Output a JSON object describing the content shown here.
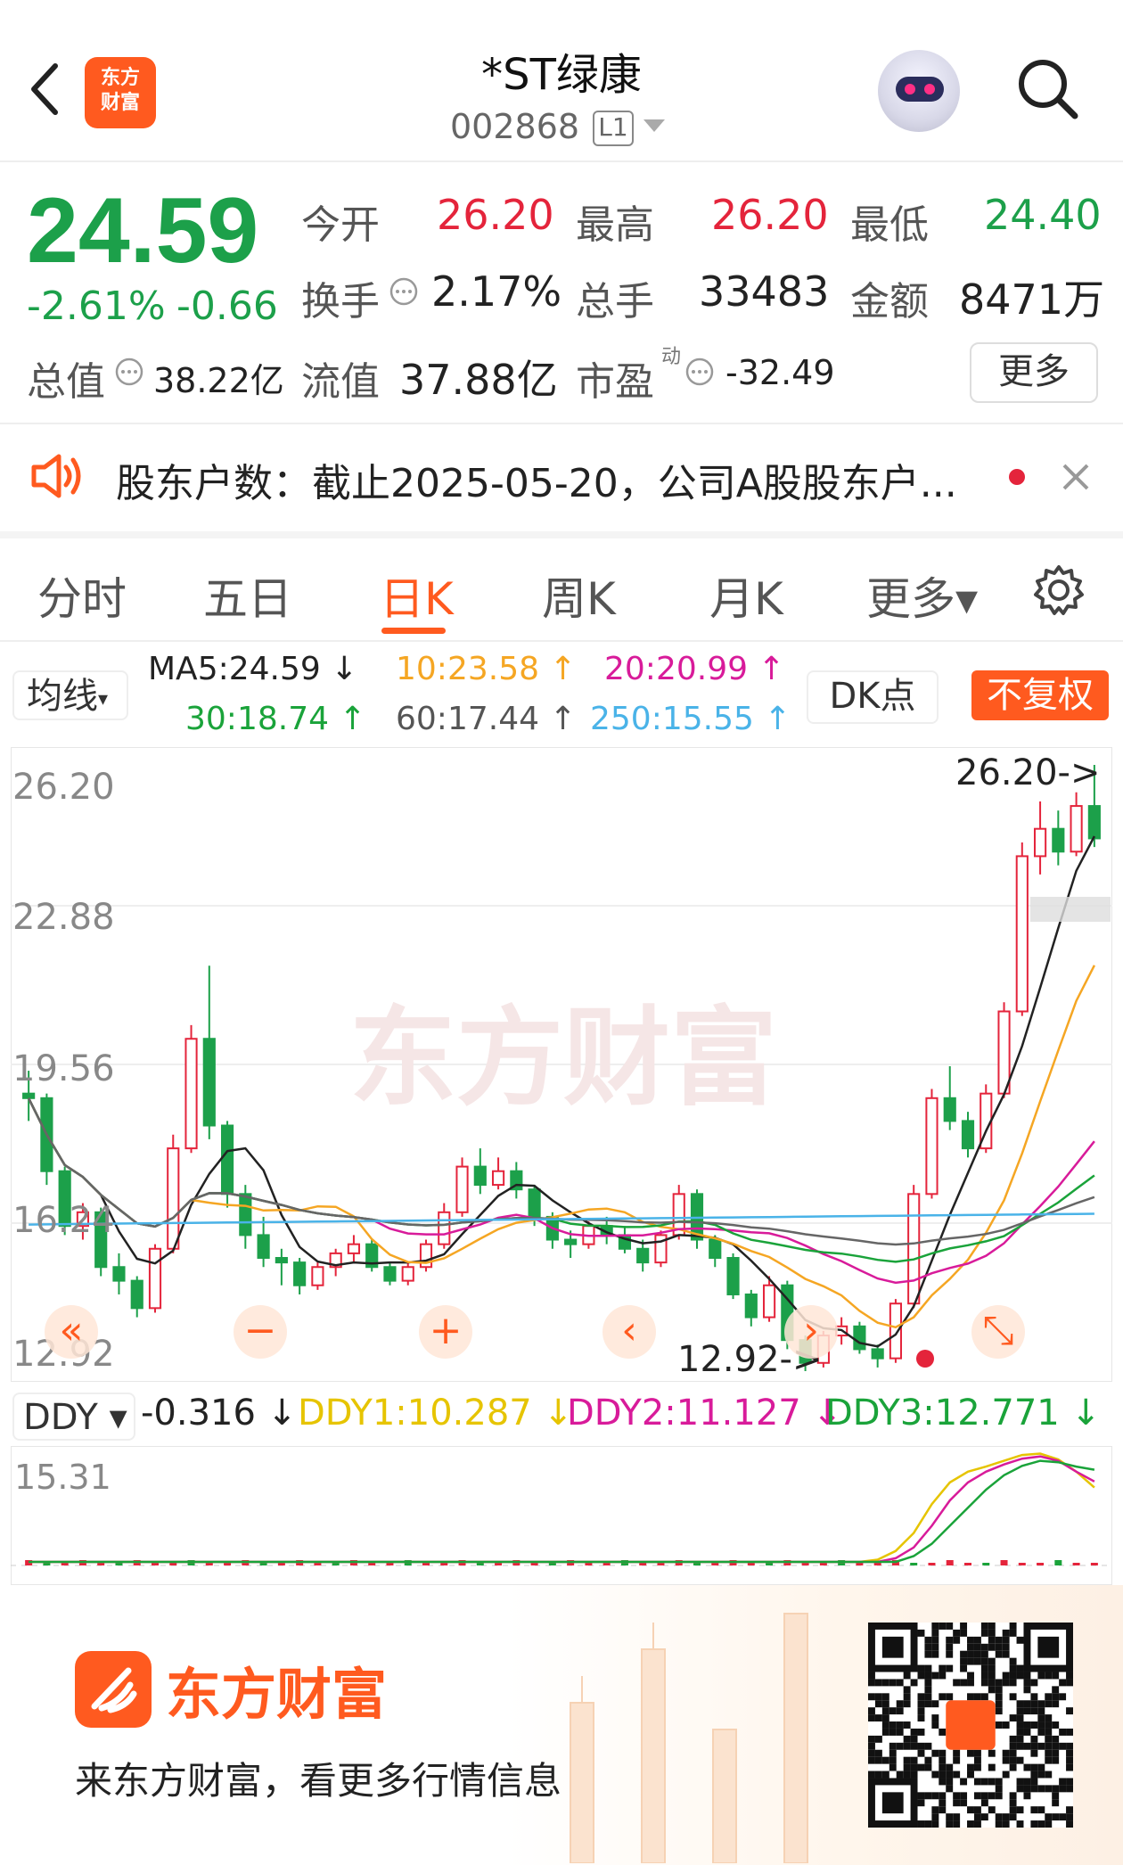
{
  "header": {
    "back_icon": "chevron-left-icon",
    "logo_badge": "东方\n财富",
    "title": "*ST绿康",
    "code": "002868",
    "level_badge": "L1",
    "avatar_icon": "robot-avatar-icon",
    "search_icon": "search-icon"
  },
  "quote": {
    "price": "24.59",
    "change_pct": "-2.61%",
    "change_abs": "-0.66",
    "open_label": "今开",
    "open": "26.20",
    "high_label": "最高",
    "high": "26.20",
    "low_label": "最低",
    "low": "24.40",
    "turnover_label": "换手",
    "turnover": "2.17%",
    "volume_label": "总手",
    "volume": "33483",
    "amount_label": "金额",
    "amount": "8471万",
    "mktcap_label": "总值",
    "mktcap": "38.22亿",
    "float_label": "流值",
    "float_cap": "37.88亿",
    "pe_label": "市盈",
    "pe_sup": "动",
    "pe": "-32.49",
    "more_label": "更多"
  },
  "notice": {
    "text": "股东户数：截止2025-05-20，公司A股股东户...",
    "icon": "speaker-icon",
    "close_icon": "close-icon"
  },
  "tabs": [
    {
      "label": "分时"
    },
    {
      "label": "五日"
    },
    {
      "label": "日K",
      "active": true
    },
    {
      "label": "周K"
    },
    {
      "label": "月K"
    },
    {
      "label": "更多▾"
    }
  ],
  "settings_icon": "gear-icon",
  "ma_bar": {
    "selector": "均线",
    "ma5": "MA5:24.59 ↓",
    "ma10": "10:23.58 ↑",
    "ma20": "20:20.99 ↑",
    "ma30": "30:18.74 ↑",
    "ma60": "60:17.44 ↑",
    "ma250": "250:15.55 ↑",
    "dk_label": "DK点",
    "adjust_label": "不复权"
  },
  "colors": {
    "up": "#e4243b",
    "down": "#1ca04a",
    "ma5": "#222222",
    "ma10": "#f5a623",
    "ma20": "#d81b9a",
    "ma30": "#1aa33a",
    "ma60": "#666666",
    "ma250": "#4ab3e8",
    "accent": "#ff5a1f"
  },
  "chart_data": {
    "type": "candlestick",
    "ylim": [
      12.92,
      26.2
    ],
    "y_ticks": [
      "26.20",
      "22.88",
      "19.56",
      "16.24",
      "12.92"
    ],
    "max_marker": "26.20->",
    "min_marker": "12.92->",
    "candles": [
      [
        19.0,
        19.5,
        18.4,
        18.9
      ],
      [
        18.9,
        19.0,
        17.0,
        17.3
      ],
      [
        17.3,
        17.4,
        15.9,
        16.1
      ],
      [
        16.1,
        16.6,
        15.8,
        16.4
      ],
      [
        16.4,
        16.5,
        15.0,
        15.2
      ],
      [
        15.2,
        15.5,
        14.6,
        14.9
      ],
      [
        14.9,
        15.0,
        14.1,
        14.3
      ],
      [
        14.3,
        15.7,
        14.2,
        15.6
      ],
      [
        15.6,
        18.1,
        15.5,
        17.8
      ],
      [
        17.8,
        20.5,
        17.7,
        20.2
      ],
      [
        20.2,
        21.8,
        18.0,
        18.3
      ],
      [
        18.3,
        18.4,
        16.5,
        16.8
      ],
      [
        16.8,
        17.0,
        15.6,
        15.9
      ],
      [
        15.9,
        16.3,
        15.2,
        15.4
      ],
      [
        15.4,
        15.6,
        14.8,
        15.3
      ],
      [
        15.3,
        15.4,
        14.6,
        14.8
      ],
      [
        14.8,
        15.3,
        14.7,
        15.2
      ],
      [
        15.2,
        15.6,
        15.0,
        15.5
      ],
      [
        15.5,
        15.9,
        15.3,
        15.7
      ],
      [
        15.7,
        15.8,
        15.1,
        15.2
      ],
      [
        15.2,
        15.3,
        14.8,
        14.9
      ],
      [
        14.9,
        15.3,
        14.8,
        15.2
      ],
      [
        15.2,
        15.8,
        15.1,
        15.7
      ],
      [
        15.7,
        16.6,
        15.6,
        16.4
      ],
      [
        16.4,
        17.6,
        16.3,
        17.4
      ],
      [
        17.4,
        17.8,
        16.8,
        17.0
      ],
      [
        17.0,
        17.6,
        16.9,
        17.3
      ],
      [
        17.3,
        17.5,
        16.7,
        16.9
      ],
      [
        16.9,
        17.0,
        16.1,
        16.3
      ],
      [
        16.3,
        16.4,
        15.6,
        15.8
      ],
      [
        15.8,
        16.0,
        15.4,
        15.7
      ],
      [
        15.7,
        16.2,
        15.6,
        16.1
      ],
      [
        16.1,
        16.3,
        15.7,
        15.9
      ],
      [
        15.9,
        16.1,
        15.5,
        15.6
      ],
      [
        15.6,
        15.8,
        15.1,
        15.3
      ],
      [
        15.3,
        16.0,
        15.2,
        15.9
      ],
      [
        15.9,
        17.0,
        15.8,
        16.8
      ],
      [
        16.8,
        16.9,
        15.6,
        15.8
      ],
      [
        15.8,
        15.9,
        15.2,
        15.4
      ],
      [
        15.4,
        15.5,
        14.5,
        14.6
      ],
      [
        14.6,
        14.7,
        13.9,
        14.1
      ],
      [
        14.1,
        15.0,
        14.0,
        14.8
      ],
      [
        14.8,
        14.9,
        13.4,
        13.6
      ],
      [
        13.6,
        13.7,
        12.92,
        13.1
      ],
      [
        13.1,
        13.8,
        13.0,
        13.7
      ],
      [
        13.7,
        14.1,
        13.5,
        13.9
      ],
      [
        13.9,
        14.0,
        13.3,
        13.4
      ],
      [
        13.4,
        13.5,
        13.0,
        13.2
      ],
      [
        13.2,
        14.5,
        13.1,
        14.4
      ],
      [
        14.4,
        17.0,
        14.3,
        16.8
      ],
      [
        16.8,
        19.1,
        16.7,
        18.9
      ],
      [
        18.9,
        19.6,
        18.2,
        18.4
      ],
      [
        18.4,
        18.6,
        17.6,
        17.8
      ],
      [
        17.8,
        19.2,
        17.7,
        19.0
      ],
      [
        19.0,
        21.0,
        18.9,
        20.8
      ],
      [
        20.8,
        24.5,
        20.7,
        24.2
      ],
      [
        24.2,
        25.4,
        23.8,
        24.8
      ],
      [
        24.8,
        25.2,
        24.0,
        24.3
      ],
      [
        24.3,
        25.6,
        24.2,
        25.3
      ],
      [
        25.3,
        26.2,
        24.4,
        24.59
      ]
    ],
    "series": [
      {
        "name": "MA5"
      },
      {
        "name": "MA10"
      },
      {
        "name": "MA20"
      },
      {
        "name": "MA30"
      },
      {
        "name": "MA60"
      },
      {
        "name": "MA250"
      }
    ]
  },
  "chart_controls": [
    {
      "name": "scroll-left-icon",
      "glyph": "«"
    },
    {
      "name": "zoom-out-icon",
      "glyph": "−"
    },
    {
      "name": "zoom-in-icon",
      "glyph": "+"
    },
    {
      "name": "prev-icon",
      "glyph": "‹"
    },
    {
      "name": "next-icon",
      "glyph": "›"
    },
    {
      "name": "expand-icon",
      "glyph": "⤡"
    }
  ],
  "ddy": {
    "selector": "DDY ▾",
    "value": "-0.316 ↓",
    "ddy1": "DDY1:10.287 ↓",
    "ddy2": "DDY2:11.127 ↓",
    "ddy3": "DDY3:12.771 ↓",
    "top_label": "15.31"
  },
  "ddy_chart": {
    "type": "line",
    "ylim": [
      -0.5,
      15.31
    ],
    "ddy1": [
      0,
      0,
      0,
      0,
      0,
      0,
      0,
      0,
      0,
      0,
      0,
      0,
      0,
      0,
      0,
      0,
      0,
      0,
      0,
      0,
      0,
      0,
      0,
      0,
      0,
      0,
      0,
      0,
      0,
      0,
      0,
      0,
      0,
      0,
      0,
      0,
      0,
      0,
      0,
      0,
      0,
      0,
      0,
      0,
      0,
      0,
      0,
      0.3,
      1.5,
      4.0,
      8.0,
      11.0,
      12.5,
      13.2,
      14.0,
      14.8,
      15.0,
      14.2,
      12.5,
      10.29
    ],
    "ddy2": [
      0,
      0,
      0,
      0,
      0,
      0,
      0,
      0,
      0,
      0,
      0,
      0,
      0,
      0,
      0,
      0,
      0,
      0,
      0,
      0,
      0,
      0,
      0,
      0,
      0,
      0,
      0,
      0,
      0,
      0,
      0,
      0,
      0,
      0,
      0,
      0,
      0,
      0,
      0,
      0,
      0,
      0,
      0,
      0,
      0,
      0,
      0,
      0,
      0.5,
      2.0,
      5.0,
      8.5,
      11.0,
      12.5,
      13.5,
      14.3,
      14.6,
      14.0,
      12.5,
      11.13
    ],
    "ddy3": [
      0,
      0,
      0,
      0,
      0,
      0,
      0,
      0,
      0,
      0,
      0,
      0,
      0,
      0,
      0,
      0,
      0,
      0,
      0,
      0,
      0,
      0,
      0,
      0,
      0,
      0,
      0,
      0,
      0,
      0,
      0,
      0,
      0,
      0,
      0,
      0,
      0,
      0,
      0,
      0,
      0,
      0,
      0,
      0,
      0,
      0,
      0,
      0,
      0,
      0.8,
      2.5,
      5.0,
      7.5,
      10.0,
      12.0,
      13.3,
      14.0,
      13.8,
      13.2,
      12.77
    ]
  },
  "promo": {
    "brand": "东方财富",
    "slogan": "来东方财富，看更多行情信息",
    "logo_icon": "eastmoney-logo-icon",
    "qr_icon": "qr-code-icon"
  }
}
